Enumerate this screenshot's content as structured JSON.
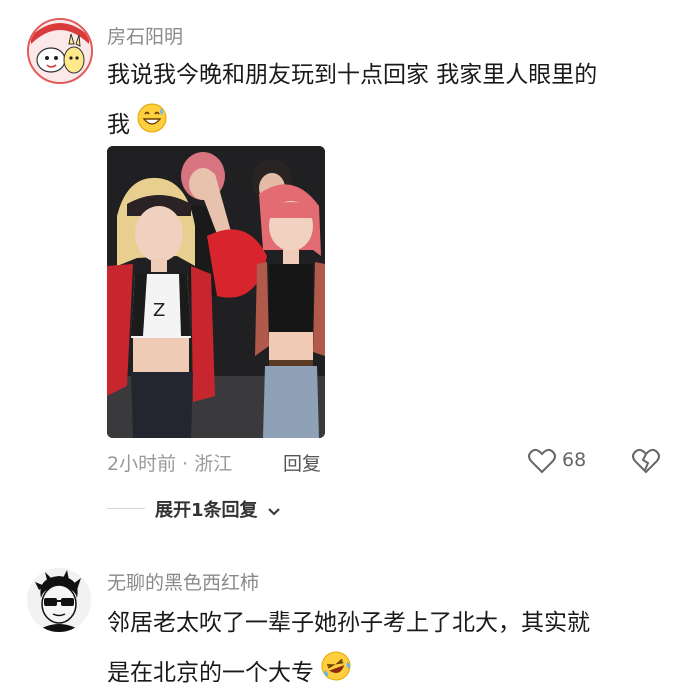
{
  "comments": [
    {
      "username": "房石阳明",
      "text": "我说我今晚和朋友玩到十点回家 我家里人眼里的我",
      "line1": "我说我今晚和朋友玩到十点回家 我家里人眼里的",
      "line2": "我",
      "emoji": "grinning-sweat-emoji",
      "meta": "2小时前 · 浙江",
      "reply_label": "回复",
      "like_count": "68",
      "expand_label": "展开1条回复"
    },
    {
      "username": "无聊的黑色西红柿",
      "line1": "邻居老太吹了一辈子她孙子考上了北大，其实就",
      "line2": "是在北京的一个大专",
      "emoji": "rofl-emoji"
    }
  ],
  "colors": {
    "username": "#8a8a8a",
    "meta": "#9a9a9a",
    "text": "#1a1a1a"
  },
  "icons": [
    "heart-icon",
    "dislike-icon",
    "chevron-down-icon"
  ]
}
